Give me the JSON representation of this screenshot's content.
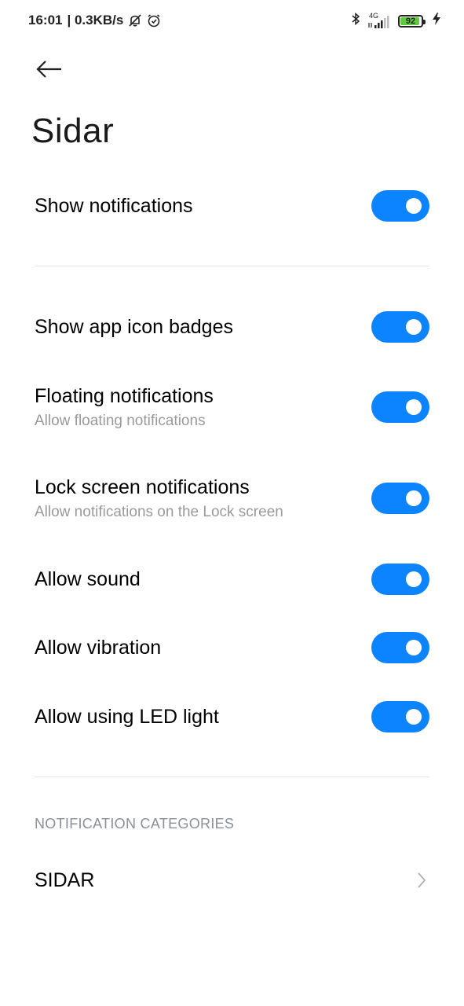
{
  "status_bar": {
    "time": "16:01",
    "network_speed": "| 0.3KB/s",
    "network_type": "4G",
    "battery_level": "92",
    "icons": [
      "notifications-off-icon",
      "alarm-icon",
      "bluetooth-icon",
      "signal-icon",
      "battery-icon",
      "charging-icon"
    ]
  },
  "header": {
    "title": "Sidar"
  },
  "settings": {
    "show_notifications": {
      "title": "Show notifications",
      "enabled": true
    },
    "app_icon_badges": {
      "title": "Show app icon badges",
      "enabled": true
    },
    "floating": {
      "title": "Floating notifications",
      "subtitle": "Allow floating notifications",
      "enabled": true
    },
    "lock_screen": {
      "title": "Lock screen notifications",
      "subtitle": "Allow notifications on the Lock screen",
      "enabled": true
    },
    "sound": {
      "title": "Allow sound",
      "enabled": true
    },
    "vibration": {
      "title": "Allow vibration",
      "enabled": true
    },
    "led": {
      "title": "Allow using LED light",
      "enabled": true
    }
  },
  "categories": {
    "header": "NOTIFICATION CATEGORIES",
    "items": [
      {
        "title": "SIDAR"
      }
    ]
  },
  "colors": {
    "toggle_on": "#0d84ff",
    "subtitle": "#9a9a9a",
    "section_header": "#8a8f99"
  }
}
